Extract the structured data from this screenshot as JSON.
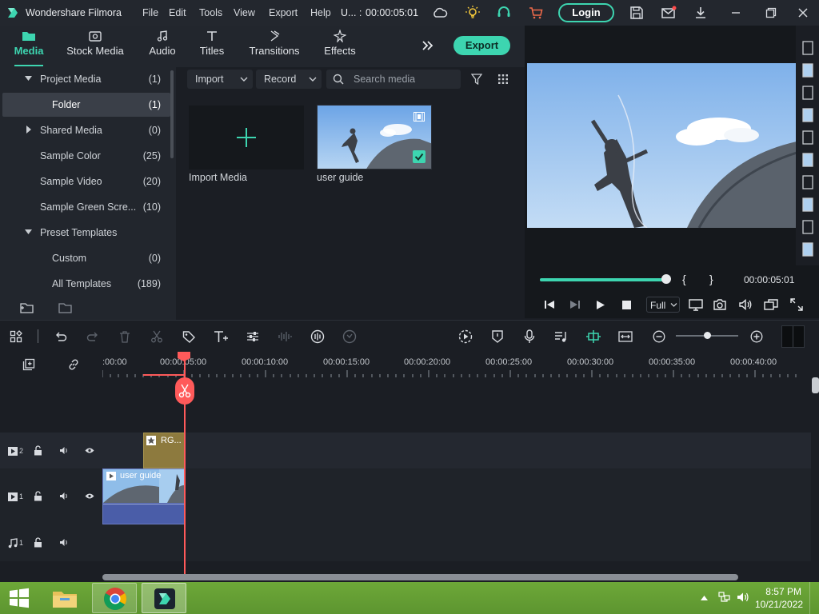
{
  "app": {
    "title": "Wondershare Filmora",
    "project": "U... :",
    "timecode": "00:00:05:01",
    "login_label": "Login"
  },
  "menu": [
    "File",
    "Edit",
    "Tools",
    "View",
    "Export",
    "Help"
  ],
  "library_tabs": [
    {
      "label": "Media",
      "icon": "media-folder-icon",
      "active": true
    },
    {
      "label": "Stock Media",
      "icon": "stock-media-icon"
    },
    {
      "label": "Audio",
      "icon": "music-note-icon"
    },
    {
      "label": "Titles",
      "icon": "text-t-icon"
    },
    {
      "label": "Transitions",
      "icon": "transitions-icon"
    },
    {
      "label": "Effects",
      "icon": "effects-sparkle-icon"
    }
  ],
  "export_label": "Export",
  "sidebar": {
    "items": [
      {
        "label": "Project Media",
        "count": "(1)"
      },
      {
        "label": "Folder",
        "count": "(1)"
      },
      {
        "label": "Shared Media",
        "count": "(0)"
      },
      {
        "label": "Sample Color",
        "count": "(25)"
      },
      {
        "label": "Sample Video",
        "count": "(20)"
      },
      {
        "label": "Sample Green Scre...",
        "count": "(10)"
      },
      {
        "label": "Preset Templates",
        "count": ""
      },
      {
        "label": "Custom",
        "count": "(0)"
      },
      {
        "label": "All Templates",
        "count": "(189)"
      }
    ]
  },
  "media_toolbar": {
    "import_label": "Import",
    "record_label": "Record",
    "search_placeholder": "Search media"
  },
  "media_items": [
    {
      "label": "Import Media"
    },
    {
      "label": "user guide"
    }
  ],
  "player": {
    "progress": 1.0,
    "timecode": "00:00:05:01",
    "quality": "Full",
    "mark_in": "{",
    "mark_out": "}"
  },
  "timeline": {
    "ruler_labels": [
      ":00:00",
      "00:00:05:00",
      "00:00:10:00",
      "00:00:15:00",
      "00:00:20:00",
      "00:00:25:00",
      "00:00:30:00",
      "00:00:35:00",
      "00:00:40:00"
    ],
    "tracks": [
      {
        "id": "video-2",
        "number": "2",
        "clip_label": "RG..."
      },
      {
        "id": "video-1",
        "number": "1",
        "clip_label": "user guide"
      },
      {
        "id": "audio-1",
        "number": "1",
        "clip_label": ""
      }
    ],
    "zoom_level": 0.5
  },
  "taskbar": {
    "time": "8:57 PM",
    "date": "10/21/2022"
  },
  "colors": {
    "accent": "#3dd5b0",
    "playhead": "#ff5a5a",
    "bg": "#1b1e24"
  }
}
